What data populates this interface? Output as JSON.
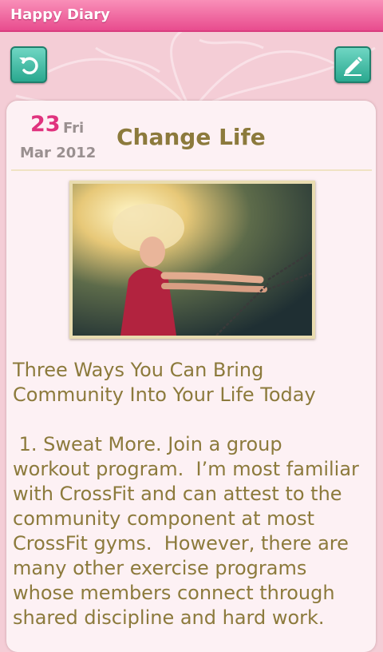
{
  "app": {
    "title": "Happy Diary"
  },
  "toolbar": {
    "back_icon": "refresh-back-icon",
    "edit_icon": "pencil-edit-icon"
  },
  "entry": {
    "day": "23",
    "weekday": "Fri",
    "month_year": "Mar 2012",
    "title": "Change Life",
    "body": "Three Ways You Can Bring\nCommunity Into Your Life Today\n\n 1. Sweat More. Join a group\nworkout program.  I’m most familiar\nwith CrossFit and can attest to the\ncommunity component at most\nCrossFit gyms.  However, there are\nmany other exercise programs\nwhose members connect through\nshared discipline and hard work."
  },
  "colors": {
    "title_bar": "#e84c8e",
    "accent_pink": "#e0337e",
    "text_gold": "#8c7a3c",
    "button_teal": "#2aa88f",
    "background": "#f4cdd6"
  }
}
